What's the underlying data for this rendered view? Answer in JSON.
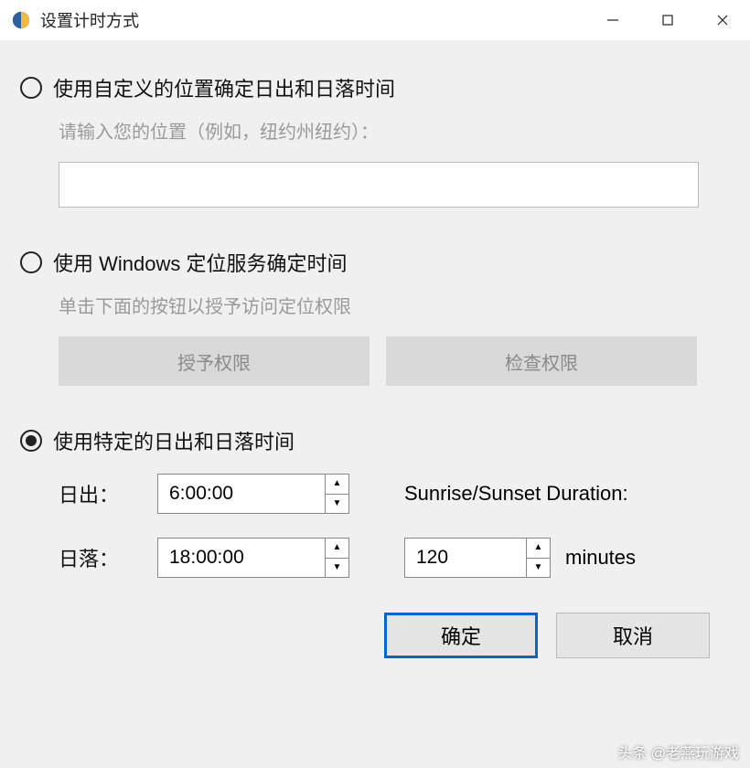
{
  "window": {
    "title": "设置计时方式"
  },
  "options": {
    "custom_location": {
      "label": "使用自定义的位置确定日出和日落时间",
      "hint": "请输入您的位置（例如，纽约州纽约）：",
      "value": ""
    },
    "windows_location": {
      "label": "使用 Windows 定位服务确定时间",
      "hint": "单击下面的按钮以授予访问定位权限",
      "grant_btn": "授予权限",
      "check_btn": "检查权限"
    },
    "fixed_time": {
      "label": "使用特定的日出和日落时间",
      "sunrise_label": "日出：",
      "sunset_label": "日落：",
      "sunrise_value": "6:00:00",
      "sunset_value": "18:00:00",
      "duration_label": "Sunrise/Sunset Duration:",
      "duration_value": "120",
      "duration_unit": "minutes"
    }
  },
  "footer": {
    "ok": "确定",
    "cancel": "取消"
  },
  "watermark": "头条 @老燕玩游戏"
}
